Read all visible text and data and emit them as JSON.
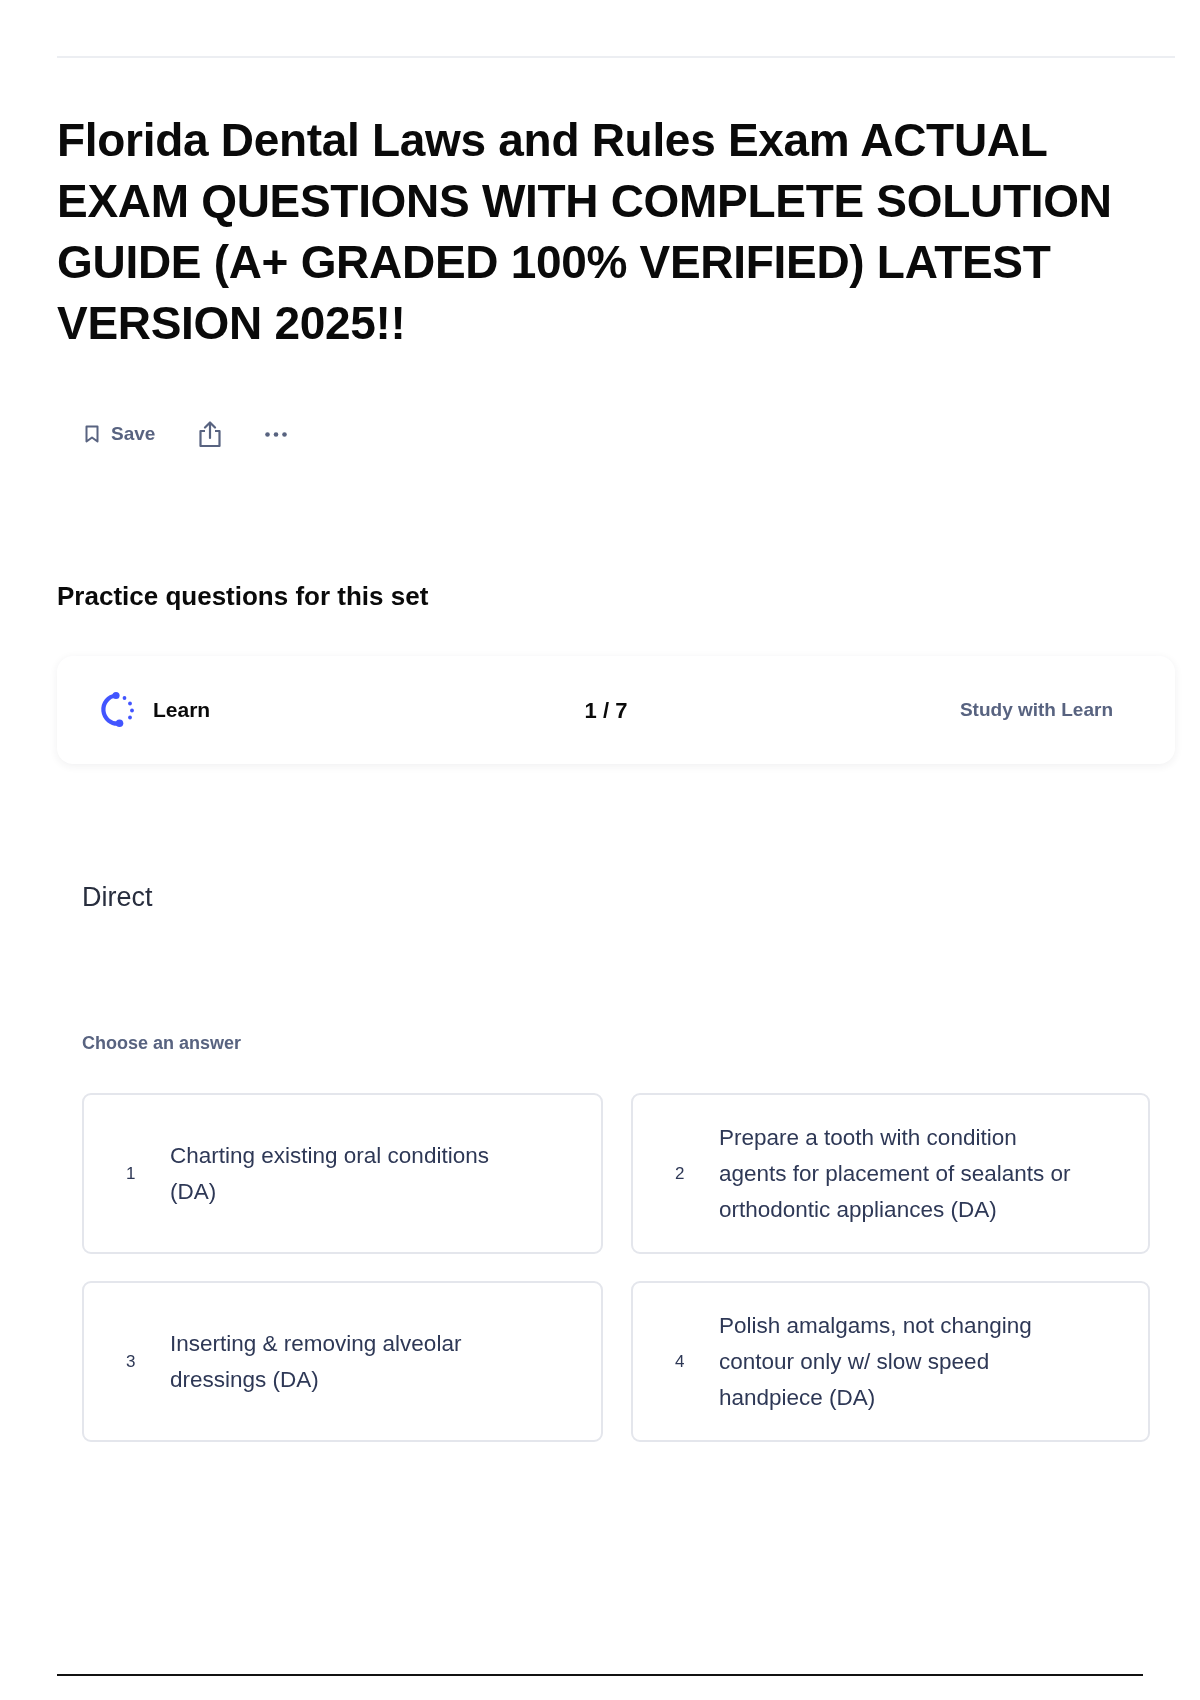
{
  "title": "Florida Dental Laws and Rules Exam ACTUAL EXAM QUESTIONS WITH COMPLETE SOLUTION GUIDE (A+ GRADED 100% VERIFIED) LATEST VERSION 2025!!",
  "actions": [
    {
      "kind": "save",
      "label": "Save"
    },
    {
      "kind": "share"
    },
    {
      "kind": "more"
    }
  ],
  "practice": {
    "heading": "Practice questions for this set",
    "learn_bar": {
      "label": "Learn",
      "progress": "1 / 7",
      "link": "Study with Learn"
    },
    "question": {
      "term": "Direct",
      "prompt": "Choose an answer",
      "answers": [
        {
          "number": "1",
          "text": "Charting existing oral conditions (DA)"
        },
        {
          "number": "2",
          "text": "Prepare a tooth with condition agents for placement of sealants or orthodontic appliances (DA)"
        },
        {
          "number": "3",
          "text": "Inserting & removing alveolar dressings (DA)"
        },
        {
          "number": "4",
          "text": "Polish amalgams, not changing contour only w/ slow speed handpiece (DA)"
        }
      ]
    }
  }
}
